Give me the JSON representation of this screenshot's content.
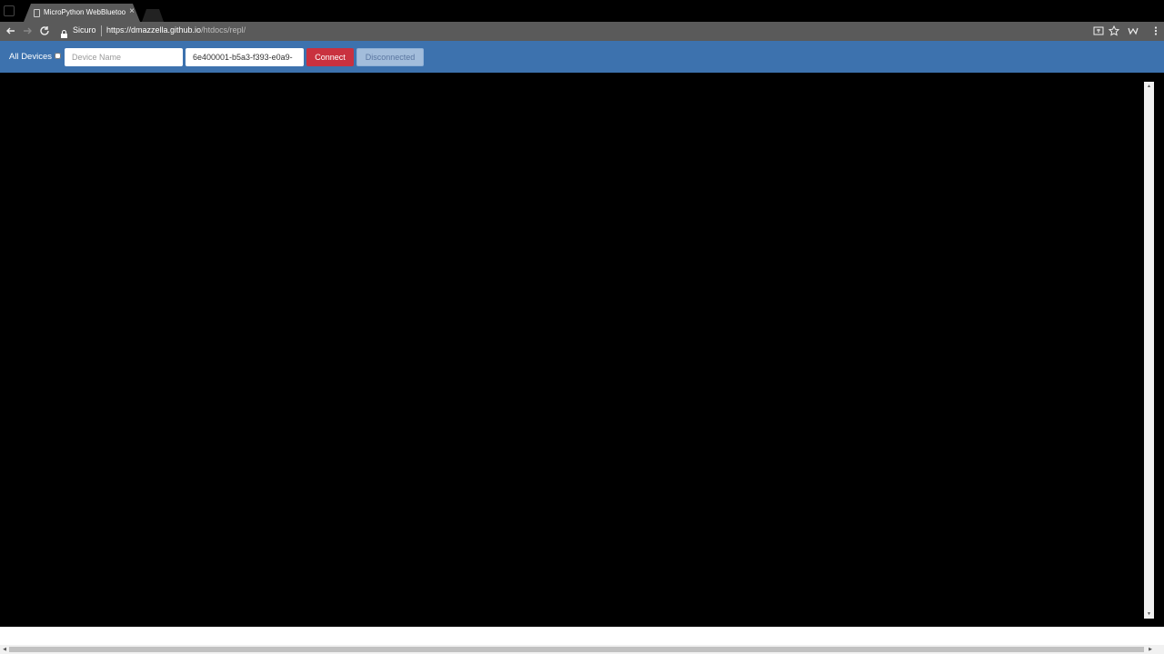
{
  "browser": {
    "tab_title": "MicroPython WebBluetooth",
    "tab_close": "×",
    "secure_label": "Sicuro",
    "url_host": "https://dmazzella.github.io",
    "url_path": "/htdocs/repl/",
    "back_icon": "arrow-left-icon",
    "forward_icon": "arrow-right-icon",
    "reload_icon": "reload-icon"
  },
  "header": {
    "all_devices_label": "All Devices",
    "device_name_placeholder": "Device Name",
    "service_uuid_value": "6e400001-b5a3-f393-e0a9-",
    "connect_label": "Connect",
    "status_label": "Disconnected"
  },
  "colors": {
    "header_bg": "#3d72ae",
    "connect_bg": "#c9313f",
    "status_bg": "#a3bddb",
    "terminal_bg": "#000000"
  }
}
